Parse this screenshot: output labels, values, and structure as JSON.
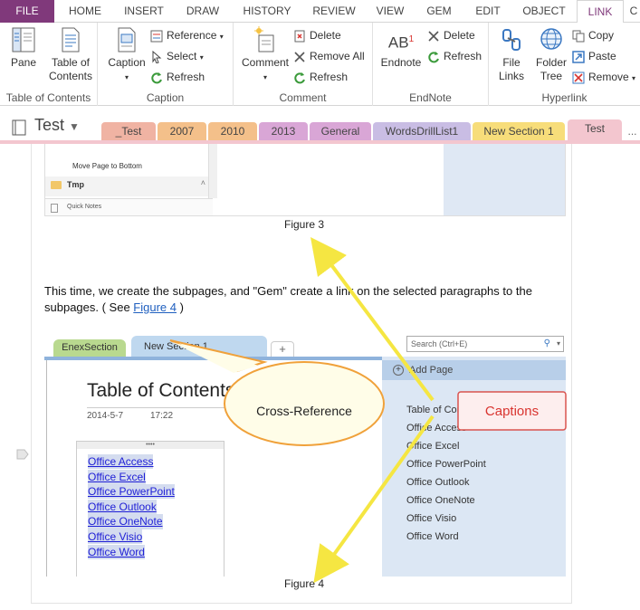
{
  "ribbon_tabs": [
    "FILE",
    "HOME",
    "INSERT",
    "DRAW",
    "HISTORY",
    "REVIEW",
    "VIEW",
    "GEM",
    "EDIT",
    "OBJECT",
    "LINK"
  ],
  "active_tab": "LINK",
  "groups": {
    "toc": {
      "label": "Table of Contents",
      "pane": "Pane",
      "toc_line1": "Table of",
      "toc_line2": "Contents"
    },
    "caption": {
      "label": "Caption",
      "caption_btn": "Caption",
      "reference": "Reference",
      "select": "Select",
      "refresh": "Refresh"
    },
    "comment": {
      "label": "Comment",
      "comment_btn": "Comment",
      "delete": "Delete",
      "remove_all": "Remove All",
      "refresh": "Refresh"
    },
    "endnote": {
      "label": "EndNote",
      "endnote_btn": "Endnote",
      "delete": "Delete",
      "refresh": "Refresh"
    },
    "hyperlink": {
      "label": "Hyperlink",
      "file_links1": "File",
      "file_links2": "Links",
      "folder_tree1": "Folder",
      "folder_tree2": "Tree",
      "copy": "Copy",
      "paste": "Paste",
      "remove": "Remove"
    }
  },
  "notebook": {
    "title": "Test"
  },
  "section_tabs": [
    {
      "label": "_Test",
      "color": "#f0b3a3"
    },
    {
      "label": "2007",
      "color": "#f4c08a"
    },
    {
      "label": "2010",
      "color": "#f4c08a"
    },
    {
      "label": "2013",
      "color": "#d9a6d6"
    },
    {
      "label": "General",
      "color": "#d9a6d6"
    },
    {
      "label": "WordsDrillList1",
      "color": "#c9bde4"
    },
    {
      "label": "New Section 1",
      "color": "#f7dd7a"
    },
    {
      "label": "Test",
      "color": "#f3c6cf"
    }
  ],
  "more_tabs": "...",
  "figure3": {
    "menu_item": "Move Page to Bottom",
    "folder": "Tmp",
    "quick_notes": "Quick Notes",
    "caption": "Figure 3"
  },
  "paragraph": {
    "text_before": "This time, we create the subpages, and \"Gem\" create a link on the selected paragraphs to the subpages. ( See ",
    "link": "Figure 4",
    "text_after": " )"
  },
  "figure4": {
    "tab_enex": "EnexSection",
    "tab_new": "New Section 1",
    "search_placeholder": "Search (Ctrl+E)",
    "add_page": "Add Page",
    "page_title": "Table of Contents",
    "date": "2014-5-7",
    "time": "17:22",
    "links": [
      "Office Access",
      "Office Excel",
      "Office PowerPoint",
      "Office Outlook",
      "Office OneNote",
      "Office Visio",
      "Office Word"
    ],
    "page_list": [
      "Table of Contents",
      "Office Access",
      "Office Excel",
      "Office PowerPoint",
      "Office Outlook",
      "Office OneNote",
      "Office Visio",
      "Office Word"
    ],
    "caption": "Figure 4"
  },
  "annotations": {
    "callout": "Cross-Reference",
    "captions_box": "Captions"
  },
  "colors": {
    "onenote_purple": "#80397b",
    "arrow_yellow": "#f5e642",
    "callout_border": "#f0a13a",
    "captions_border": "#d9534f",
    "captions_text": "#d9342f",
    "link_blue": "#1f5fbf"
  }
}
